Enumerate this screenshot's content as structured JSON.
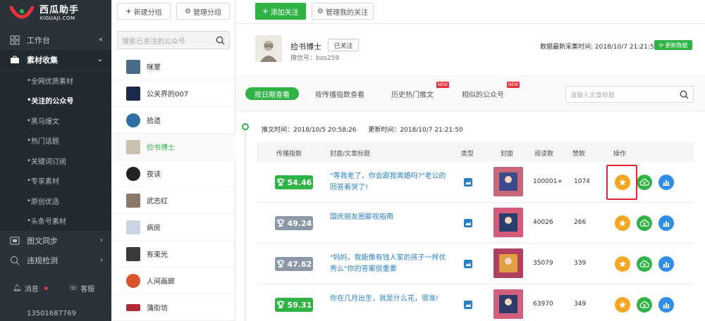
{
  "brand": {
    "name_cn": "西瓜助手",
    "name_en": "XIGUAJI.COM",
    "color": "#e8323c"
  },
  "sidebar": {
    "workbench": "工作台",
    "material": "素材收集",
    "submenu": [
      "全网优质素材",
      "关注的公众号",
      "黑马爆文",
      "热门话题",
      "关键词订阅",
      "专享素材",
      "原创优选",
      "头条号素材"
    ],
    "sync": "图文同步",
    "check": "违规检测",
    "messages": "消息",
    "service": "客服",
    "phone": "13501687769"
  },
  "account_col": {
    "new_group": "新建分组",
    "manage_group": "管理分组",
    "search_placeholder": "搜索已关注的公众号",
    "accounts": [
      "咪蒙",
      "公关界的007",
      "拾遗",
      "捡书博士",
      "夜读",
      "武志红",
      "病房",
      "有束光",
      "人间画廊",
      "蒲街坊"
    ]
  },
  "main": {
    "add_follow": "添加关注",
    "manage_follow": "管理我的关注",
    "profile": {
      "name": "捡书博士",
      "followed": "已关注",
      "wechat_id": "微信号：bos259"
    },
    "update_time": "数据最新采集时间: 2018/10/7 21:21:50",
    "update_btn": "更新数据",
    "tabs": [
      "按日期查看",
      "按传播指数查看",
      "历史热门推文",
      "相似的公众号"
    ],
    "new_badge": "NEW",
    "search_placeholder": "请输入文章标题",
    "post_time": "推文时间：2018/10/5 20:58:26",
    "update_time2": "更新时间：2018/10/7 21:21:50",
    "headers": [
      "传播指数",
      "封面/文章标题",
      "类型",
      "封面",
      "阅读数",
      "赞数",
      "操作"
    ],
    "rows": [
      {
        "score": "54.46",
        "title": "\"等我老了，你会跟我离婚吗?\"老公的回答着哭了!",
        "reads": "100001+",
        "likes": "1074",
        "score_color": "#2fb345"
      },
      {
        "score": "49.24",
        "title": "国庆朋友圈鄙视指南",
        "reads": "40026",
        "likes": "266",
        "score_color": "#8a98a8"
      },
      {
        "score": "47.62",
        "title": "\"妈妈，我能像有钱人家的孩子一样优秀么\"你的答案很重要",
        "reads": "35079",
        "likes": "339",
        "score_color": "#8a98a8"
      },
      {
        "score": "59.31",
        "title": "你在几月出生，就是什么花，很准!",
        "reads": "63970",
        "likes": "349",
        "score_color": "#2fb345"
      }
    ]
  },
  "colors": {
    "green": "#2fb345",
    "blue": "#2b80c5",
    "orange": "#f5a623",
    "op_blue": "#2d8ee8",
    "highlight": "#e3262b"
  }
}
